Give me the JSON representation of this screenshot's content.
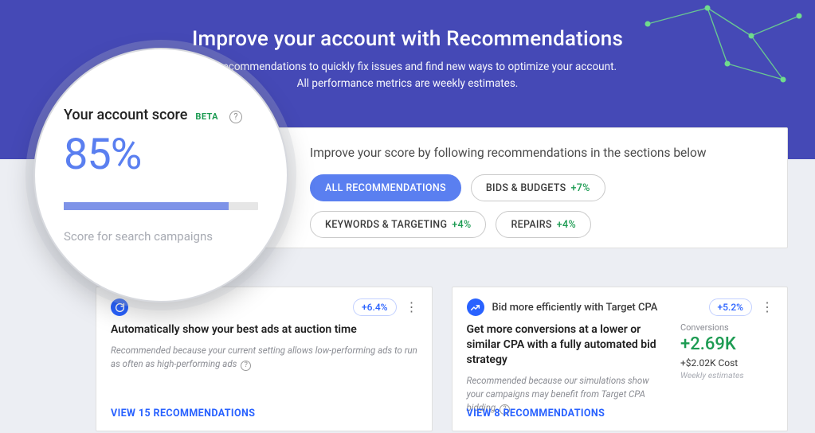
{
  "banner": {
    "title": "Improve your account with Recommendations",
    "line1": "Use recommendations to quickly fix issues and find new ways to optimize your account.",
    "line2": "All performance metrics are weekly estimates."
  },
  "lens": {
    "title": "Your account score",
    "beta": "BETA",
    "help": "?",
    "value": "85%",
    "progress_pct": 85,
    "subtitle": "Score for search campaigns"
  },
  "filters": {
    "heading": "Improve your score by following recommendations in the sections below",
    "items": [
      {
        "label": "ALL RECOMMENDATIONS",
        "pct": "",
        "active": true
      },
      {
        "label": "BIDS & BUDGETS",
        "pct": "+7%",
        "active": false
      },
      {
        "label": "KEYWORDS & TARGETING",
        "pct": "+4%",
        "active": false
      },
      {
        "label": "REPAIRS",
        "pct": "+4%",
        "active": false
      }
    ]
  },
  "tiles": [
    {
      "icon": "refresh",
      "name": "",
      "score": "+6.4%",
      "headline": "Automatically show your best ads at auction time",
      "sub": "Recommended because your current setting allows low-performing ads to run as often as high-performing ads",
      "link": "VIEW 15 RECOMMENDATIONS",
      "metrics": null
    },
    {
      "icon": "trend",
      "name": "Bid more efficiently with Target CPA",
      "score": "+5.2%",
      "headline": "Get more conversions at a lower or similar CPA with a fully automated bid strategy",
      "sub": "Recommended because our simulations show your campaigns may benefit from Target CPA bidding",
      "link": "VIEW 8 RECOMMENDATIONS",
      "metrics": {
        "label": "Conversions",
        "value": "+2.69K",
        "line": "+$2.02K Cost",
        "note": "Weekly estimates"
      }
    }
  ]
}
